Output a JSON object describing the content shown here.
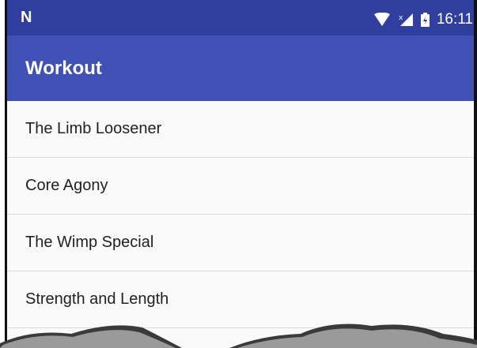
{
  "status_bar": {
    "carrier_glyph": "N",
    "time": "16:11",
    "icons": [
      "wifi-icon",
      "signal-icon",
      "battery-icon"
    ]
  },
  "app_bar": {
    "title": "Workout",
    "color": "#3f51b5",
    "status_color": "#303f9f"
  },
  "list": {
    "items": [
      {
        "label": "The Limb Loosener"
      },
      {
        "label": "Core Agony"
      },
      {
        "label": "The Wimp Special"
      },
      {
        "label": "Strength and Length"
      }
    ]
  }
}
